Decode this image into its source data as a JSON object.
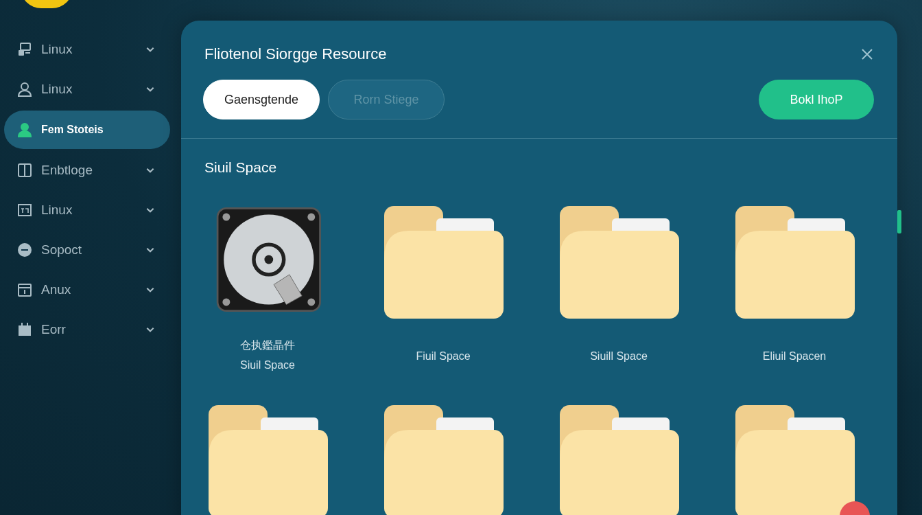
{
  "sidebar": {
    "items": [
      {
        "label": "Linux",
        "kind": "server",
        "selected": false
      },
      {
        "label": "Linux",
        "kind": "user",
        "selected": false
      },
      {
        "label": "Fem Stoteis",
        "kind": "user",
        "selected": true
      },
      {
        "label": "Enbtloge",
        "kind": "book",
        "selected": false
      },
      {
        "label": "Linux",
        "kind": "window",
        "selected": false
      },
      {
        "label": "Sopoct",
        "kind": "disc",
        "selected": false
      },
      {
        "label": "Anux",
        "kind": "calendar",
        "selected": false
      },
      {
        "label": "Eorr",
        "kind": "box",
        "selected": false
      }
    ]
  },
  "dialog": {
    "title": "Fliotenol Siorgge Resource",
    "tabs": [
      {
        "label": "Gaensgtende",
        "selected": true
      },
      {
        "label": "Rorn Stiege",
        "selected": false
      }
    ],
    "action_button": "Bokl IhoP",
    "section_title": "Siuil Space",
    "items": [
      {
        "kind": "drive",
        "lines": [
          "仓执鑑晶件",
          "Siuil Space"
        ]
      },
      {
        "kind": "folder",
        "lines": [
          "Fiuil Space"
        ]
      },
      {
        "kind": "folder",
        "lines": [
          "Siuill Space"
        ]
      },
      {
        "kind": "folder",
        "lines": [
          "Eliuil Spacen"
        ]
      },
      {
        "kind": "folder"
      },
      {
        "kind": "folder"
      },
      {
        "kind": "folder"
      },
      {
        "kind": "folder"
      }
    ]
  }
}
